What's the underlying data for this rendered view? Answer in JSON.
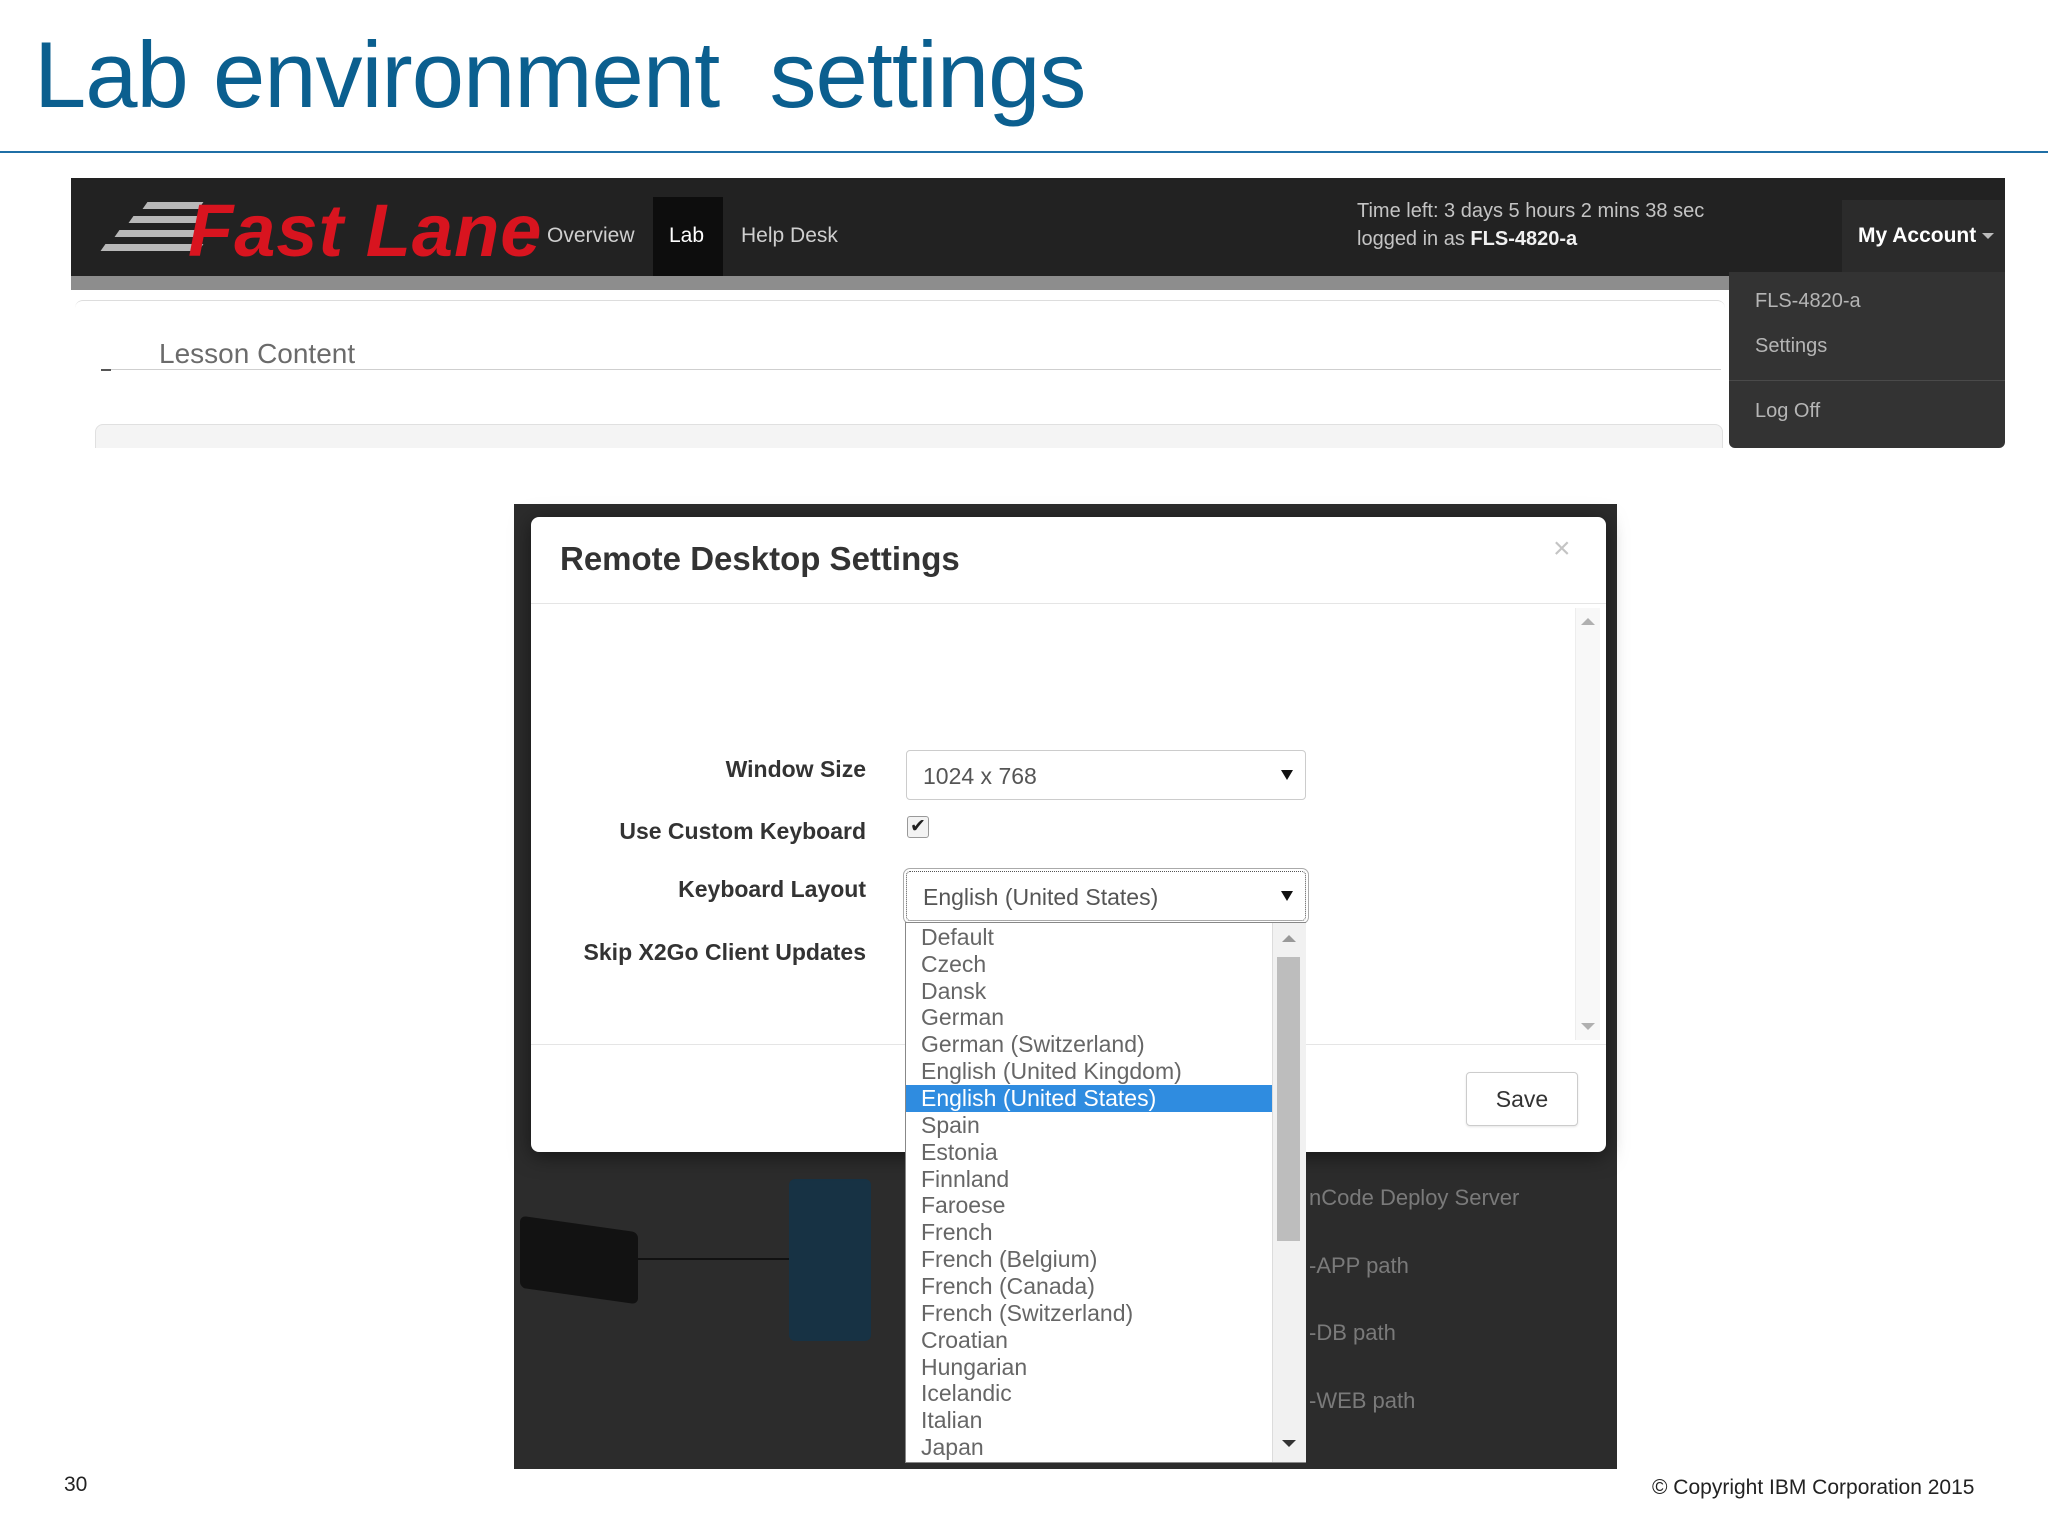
{
  "slide": {
    "title": "Lab environment  settings",
    "page_number": "30",
    "copyright": "© Copyright IBM Corporation 2015"
  },
  "portal": {
    "logo_text": "Fast Lane",
    "nav": [
      "Overview",
      "Lab",
      "Help Desk"
    ],
    "active_nav": "Lab",
    "time_left": "Time left: 3 days 5 hours 2 mins 38 sec",
    "logged_in_prefix": "logged in as ",
    "username": "FLS-4820-a",
    "account_button": "My Account",
    "account_menu": [
      "FLS-4820-a",
      "Settings",
      "Log Off"
    ],
    "lesson_content": "Lesson Content"
  },
  "dialog": {
    "title": "Remote Desktop Settings",
    "close_glyph": "×",
    "fields": {
      "window_size_label": "Window Size",
      "window_size_value": "1024 x 768",
      "custom_keyboard_label": "Use Custom Keyboard",
      "custom_keyboard_checked": true,
      "keyboard_layout_label": "Keyboard Layout",
      "keyboard_layout_value": "English (United States)",
      "skip_updates_label": "Skip X2Go Client Updates"
    },
    "save_label": "Save",
    "keyboard_options": [
      "Default",
      "Czech",
      "Dansk",
      "German",
      "German (Switzerland)",
      "English (United Kingdom)",
      "English (United States)",
      "Spain",
      "Estonia",
      "Finnland",
      "Faroese",
      "French",
      "French (Belgium)",
      "French (Canada)",
      "French (Switzerland)",
      "Croatian",
      "Hungarian",
      "Icelandic",
      "Italian",
      "Japan"
    ],
    "selected_option": "English (United States)"
  },
  "background_labels": [
    "nCode Deploy Server",
    "-APP path",
    "-DB path",
    "-WEB path"
  ],
  "icons": {
    "checkbox": "checkmark-icon",
    "dropdown_arrow": "triangle-down-icon",
    "close": "close-icon"
  },
  "colors": {
    "title_blue": "#0b5f8f",
    "logo_red": "#d8141f",
    "selection_blue": "#2f8ce0"
  }
}
